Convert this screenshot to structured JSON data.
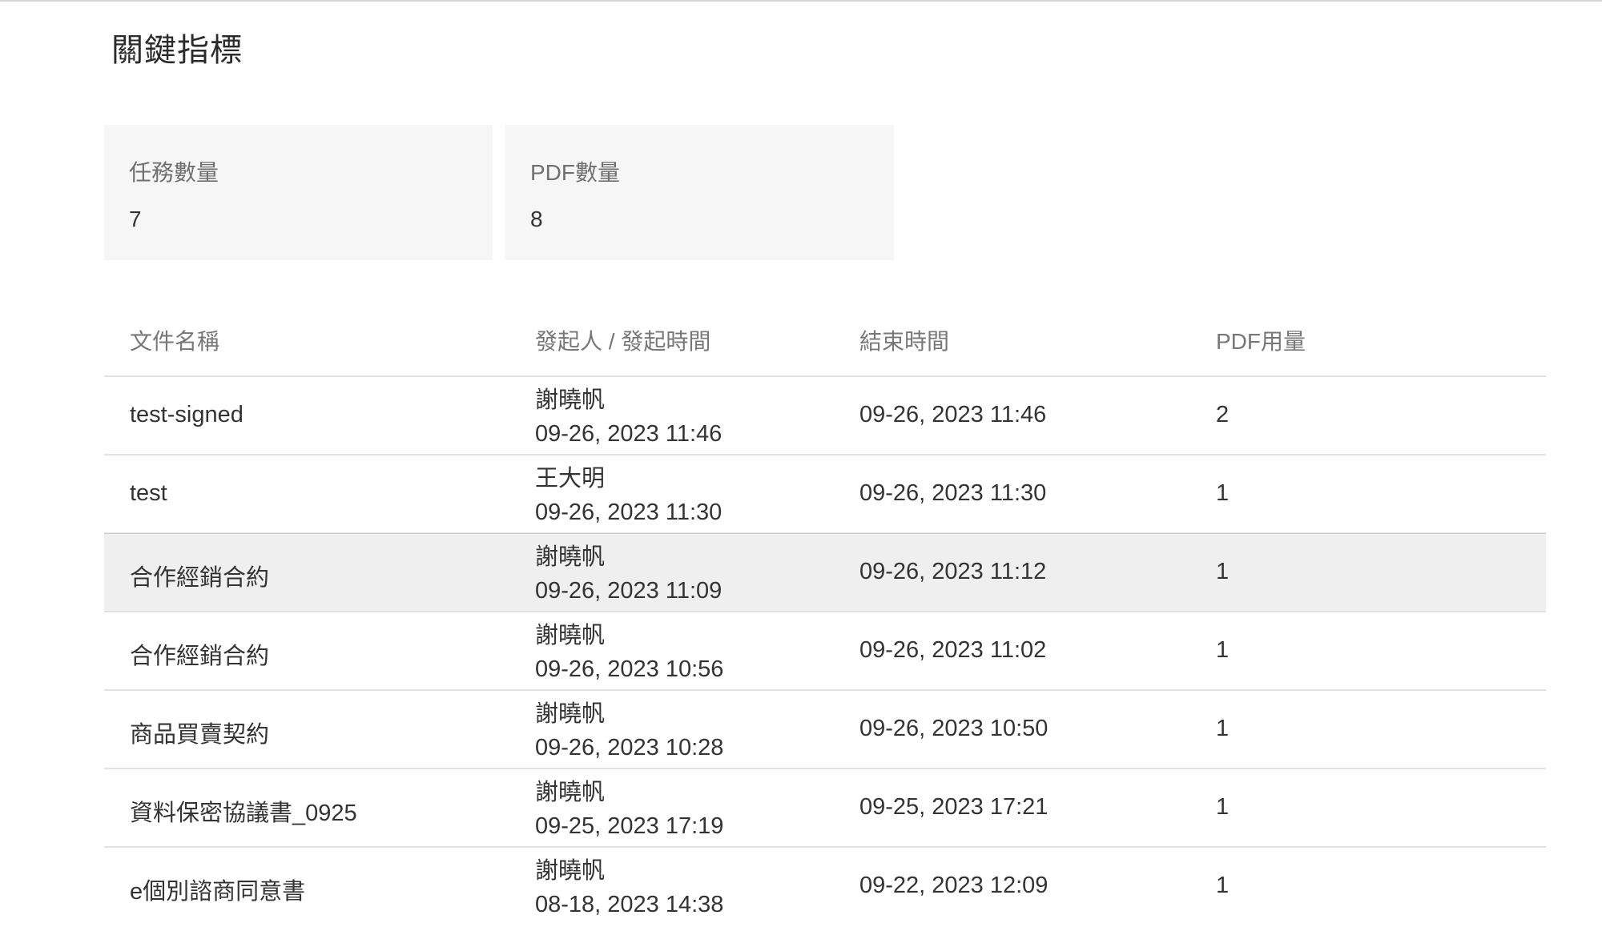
{
  "page": {
    "title": "關鍵指標"
  },
  "kpis": [
    {
      "label": "任務數量",
      "value": "7"
    },
    {
      "label": "PDF數量",
      "value": "8"
    }
  ],
  "table": {
    "headers": [
      "文件名稱",
      "發起人 / 發起時間",
      "結束時間",
      "PDF用量"
    ],
    "rows": [
      {
        "name": "test-signed",
        "initiator": "謝曉帆",
        "start": "09-26, 2023 11:46",
        "end": "09-26, 2023 11:46",
        "pdf": "2"
      },
      {
        "name": "test",
        "initiator": "王大明",
        "start": "09-26, 2023 11:30",
        "end": "09-26, 2023 11:30",
        "pdf": "1"
      },
      {
        "name": "合作經銷合約",
        "initiator": "謝曉帆",
        "start": "09-26, 2023 11:09",
        "end": "09-26, 2023 11:12",
        "pdf": "1"
      },
      {
        "name": "合作經銷合約",
        "initiator": "謝曉帆",
        "start": "09-26, 2023 10:56",
        "end": "09-26, 2023 11:02",
        "pdf": "1"
      },
      {
        "name": "商品買賣契約",
        "initiator": "謝曉帆",
        "start": "09-26, 2023 10:28",
        "end": "09-26, 2023 10:50",
        "pdf": "1"
      },
      {
        "name": "資料保密協議書_0925",
        "initiator": "謝曉帆",
        "start": "09-25, 2023 17:19",
        "end": "09-25, 2023 17:21",
        "pdf": "1"
      },
      {
        "name": "e個別諮商同意書",
        "initiator": "謝曉帆",
        "start": "08-18, 2023 14:38",
        "end": "09-22, 2023 12:09",
        "pdf": "1"
      }
    ]
  }
}
